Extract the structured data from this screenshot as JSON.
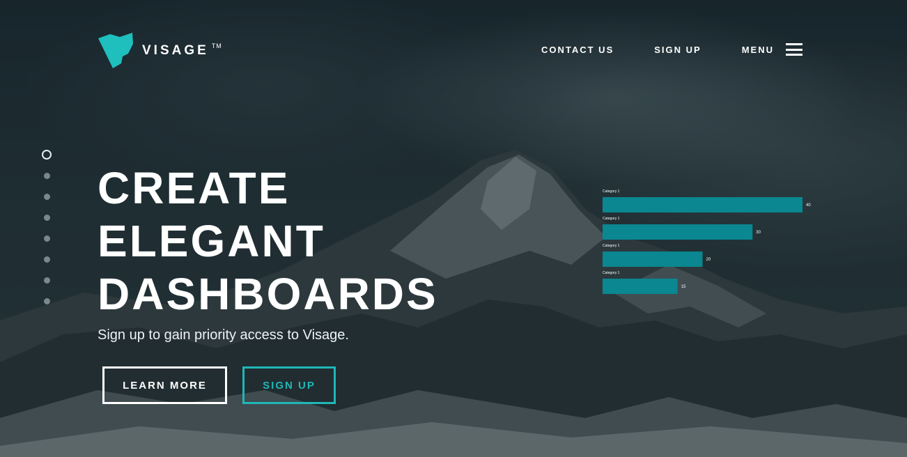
{
  "brand": {
    "name": "VISAGE",
    "trademark": "TM",
    "accent": "#1fbfbd"
  },
  "nav": {
    "contact_label": "CONTACT US",
    "signup_label": "SIGN UP",
    "menu_label": "MENU"
  },
  "slider": {
    "count": 8,
    "active_index": 0
  },
  "hero": {
    "title_lines": [
      "CREATE",
      "ELEGANT",
      "DASHBOARDS"
    ],
    "subtitle": "Sign up to gain priority access to Visage.",
    "learn_more_label": "LEARN MORE",
    "sign_up_label": "SIGN UP"
  },
  "colors": {
    "bar": "#0a8790",
    "button_accent": "#20b7b6",
    "text": "#ffffff"
  },
  "chart_data": {
    "type": "bar",
    "orientation": "horizontal",
    "categories": [
      "Category 1",
      "Category 1",
      "Category 1",
      "Category 1"
    ],
    "values": [
      40,
      30,
      20,
      15
    ],
    "title": "",
    "xlabel": "",
    "ylabel": "",
    "xlim": [
      0,
      40
    ],
    "grid": false
  }
}
